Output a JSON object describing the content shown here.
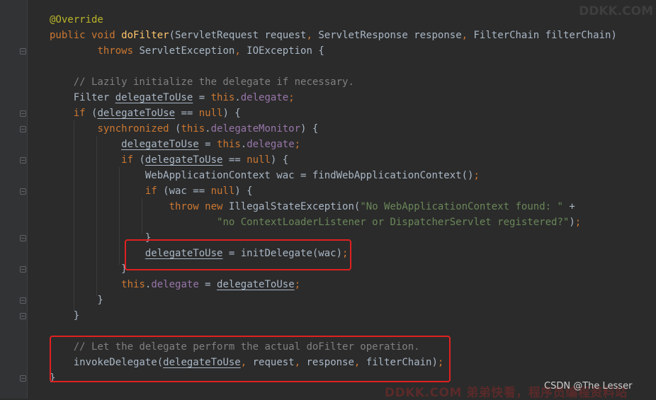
{
  "code_lines": [
    "@Override",
    "public void doFilter(ServletRequest request, ServletResponse response, FilterChain filterChain)",
    "        throws ServletException, IOException {",
    "",
    "    // Lazily initialize the delegate if necessary.",
    "    Filter delegateToUse = this.delegate;",
    "    if (delegateToUse == null) {",
    "        synchronized (this.delegateMonitor) {",
    "            delegateToUse = this.delegate;",
    "            if (delegateToUse == null) {",
    "                WebApplicationContext wac = findWebApplicationContext();",
    "                if (wac == null) {",
    "                    throw new IllegalStateException(\"No WebApplicationContext found: \" +",
    "                            \"no ContextLoaderListener or DispatcherServlet registered?\");",
    "                }",
    "                delegateToUse = initDelegate(wac);",
    "            }",
    "            this.delegate = delegateToUse;",
    "        }",
    "    }",
    "",
    "    // Let the delegate perform the actual doFilter operation.",
    "    invokeDelegate(delegateToUse, request, response, filterChain);",
    "}"
  ],
  "highlighted_lines": [
    15,
    21,
    22
  ],
  "watermark_top": "DDKK.COM",
  "watermark_bottom": "DDKK.COM 弟弟快看，程序员编程资料站",
  "credit": "CSDN @The Lesser"
}
